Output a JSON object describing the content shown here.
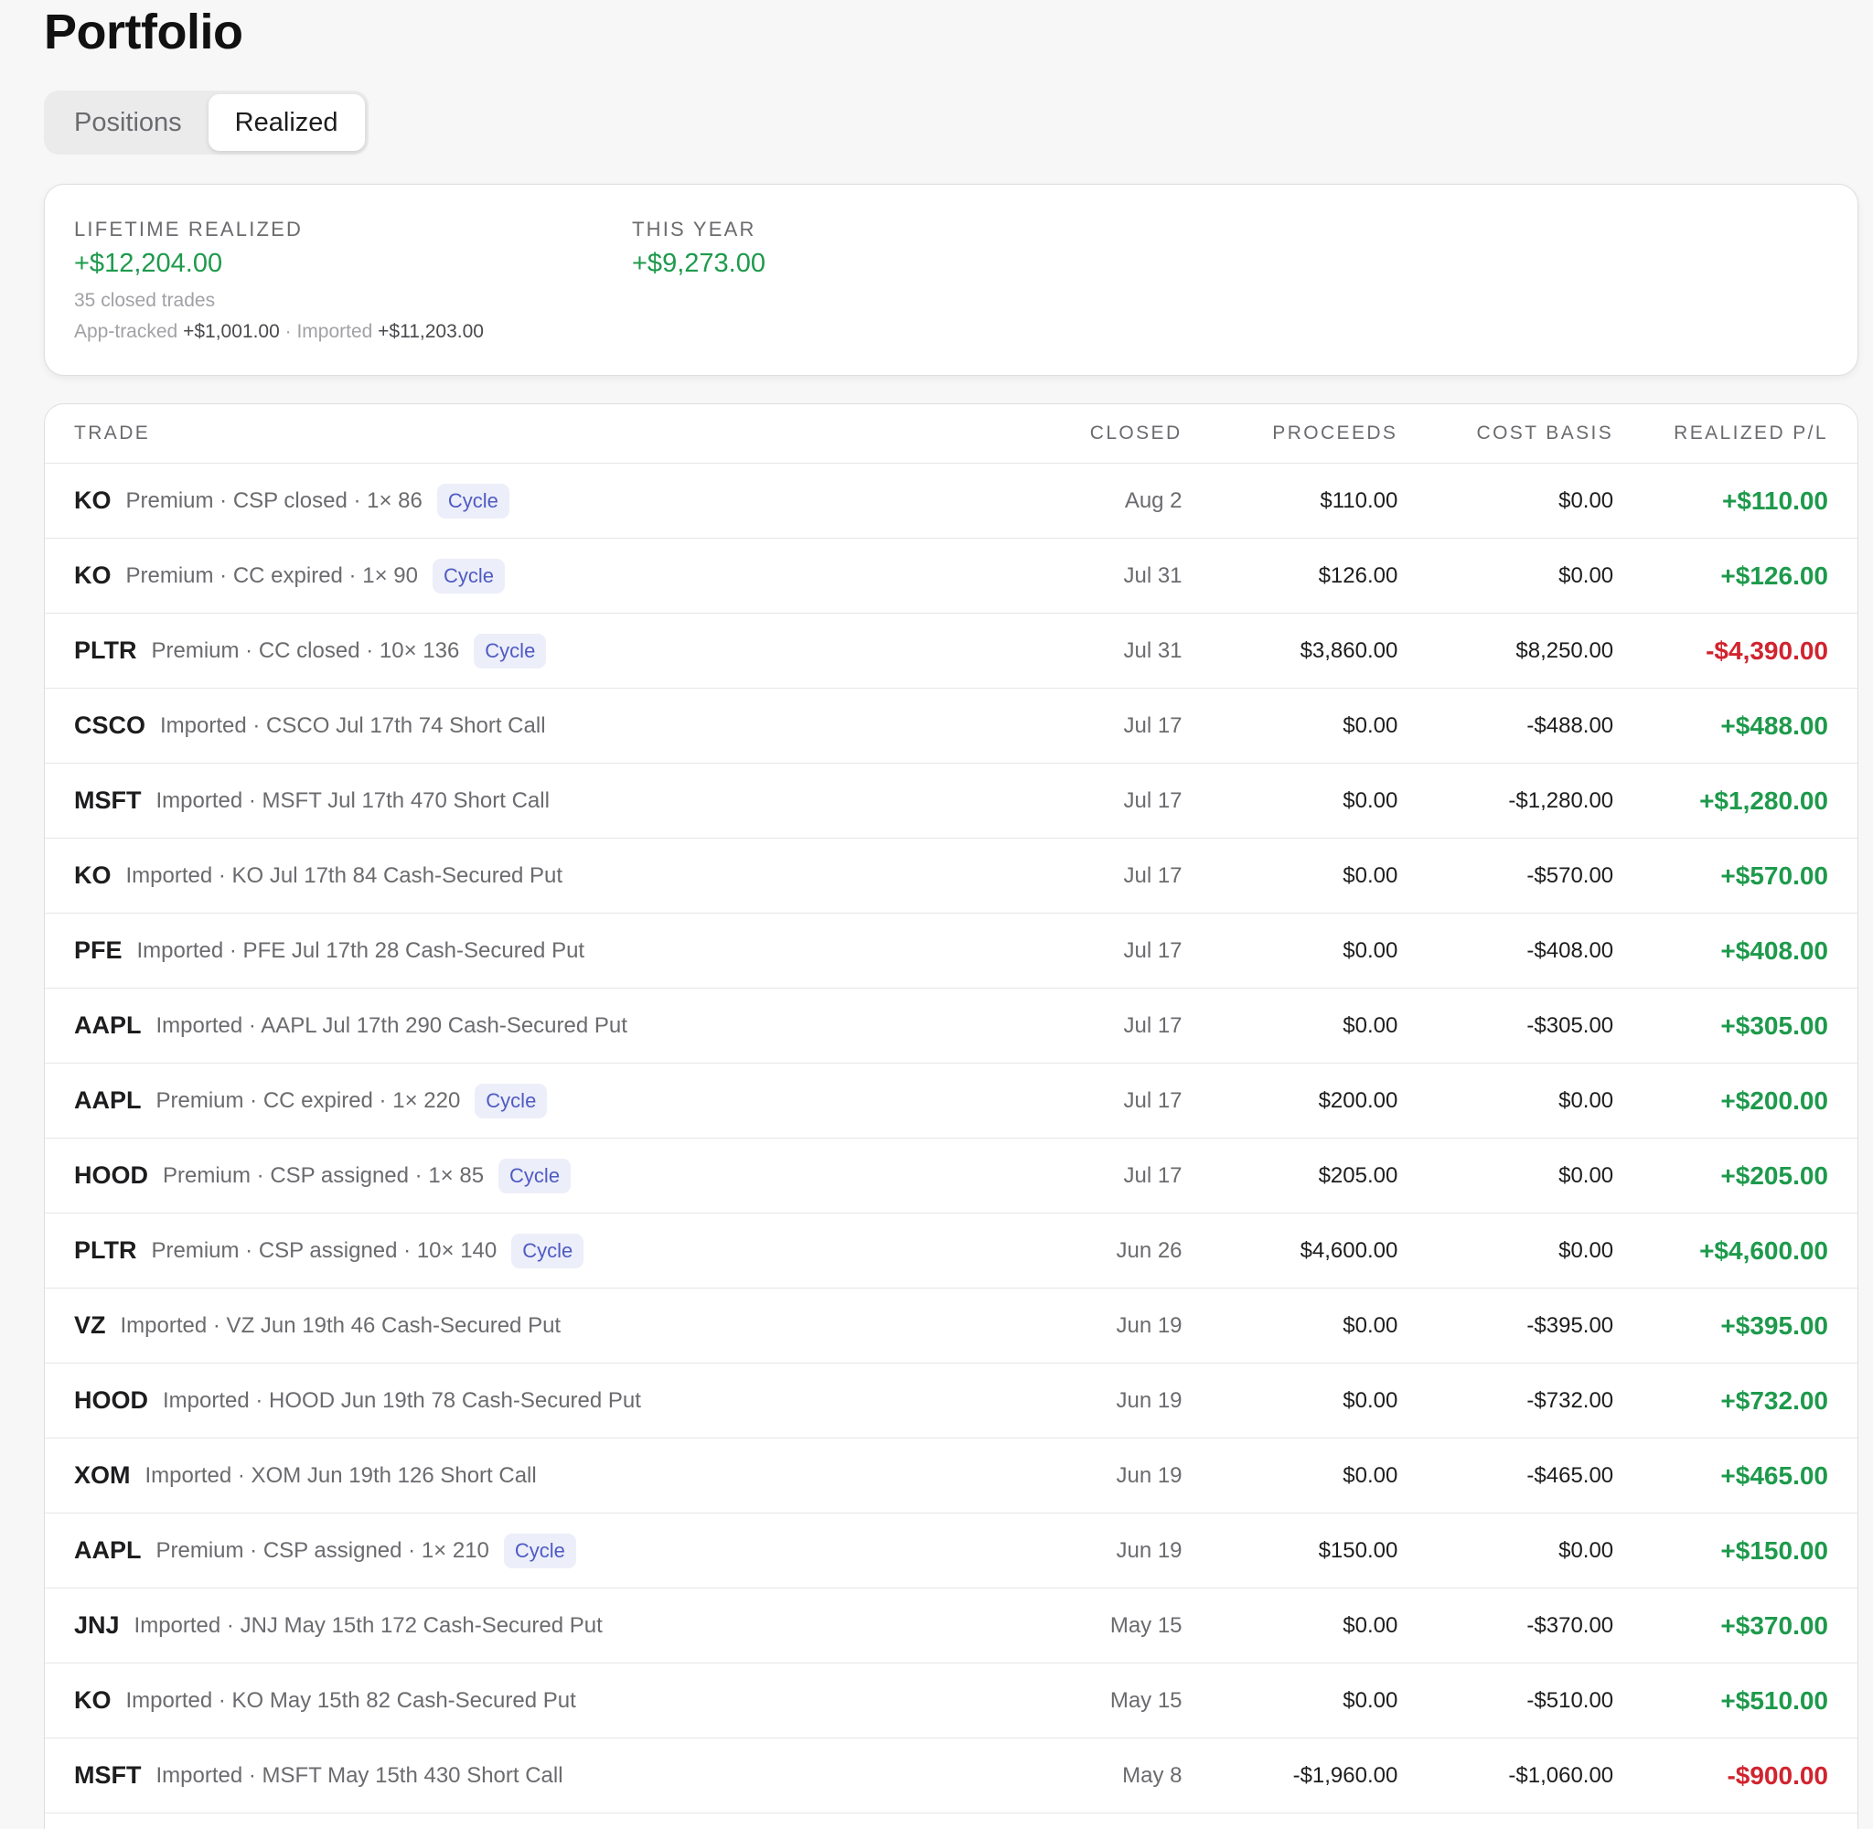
{
  "page": {
    "title": "Portfolio"
  },
  "tabs": [
    {
      "label": "Positions",
      "active": false
    },
    {
      "label": "Realized",
      "active": true
    }
  ],
  "summary": {
    "lifetime": {
      "label": "LIFETIME REALIZED",
      "value": "+$12,204.00",
      "closed_trades": "35 closed trades",
      "app_tracked_label": "App-tracked",
      "app_tracked_value": "+$1,001.00",
      "separator": "·",
      "imported_label": "Imported",
      "imported_value": "+$11,203.00"
    },
    "this_year": {
      "label": "THIS YEAR",
      "value": "+$9,273.00"
    }
  },
  "table": {
    "headers": {
      "trade": "TRADE",
      "closed": "CLOSED",
      "proceeds": "PROCEEDS",
      "cost_basis": "COST BASIS",
      "realized_pl": "REALIZED P/L"
    },
    "rows": [
      {
        "ticker": "KO",
        "desc": "Premium · CSP closed · 1× 86",
        "badge": "Cycle",
        "closed": "Aug 2",
        "proceeds": "$110.00",
        "cost": "$0.00",
        "pl": "+$110.00",
        "pl_sign": "pos"
      },
      {
        "ticker": "KO",
        "desc": "Premium · CC expired · 1× 90",
        "badge": "Cycle",
        "closed": "Jul 31",
        "proceeds": "$126.00",
        "cost": "$0.00",
        "pl": "+$126.00",
        "pl_sign": "pos"
      },
      {
        "ticker": "PLTR",
        "desc": "Premium · CC closed · 10× 136",
        "badge": "Cycle",
        "closed": "Jul 31",
        "proceeds": "$3,860.00",
        "cost": "$8,250.00",
        "pl": "-$4,390.00",
        "pl_sign": "neg"
      },
      {
        "ticker": "CSCO",
        "desc": "Imported · CSCO Jul 17th 74 Short Call",
        "badge": null,
        "closed": "Jul 17",
        "proceeds": "$0.00",
        "cost": "-$488.00",
        "pl": "+$488.00",
        "pl_sign": "pos"
      },
      {
        "ticker": "MSFT",
        "desc": "Imported · MSFT Jul 17th 470 Short Call",
        "badge": null,
        "closed": "Jul 17",
        "proceeds": "$0.00",
        "cost": "-$1,280.00",
        "pl": "+$1,280.00",
        "pl_sign": "pos"
      },
      {
        "ticker": "KO",
        "desc": "Imported · KO Jul 17th 84 Cash-Secured Put",
        "badge": null,
        "closed": "Jul 17",
        "proceeds": "$0.00",
        "cost": "-$570.00",
        "pl": "+$570.00",
        "pl_sign": "pos"
      },
      {
        "ticker": "PFE",
        "desc": "Imported · PFE Jul 17th 28 Cash-Secured Put",
        "badge": null,
        "closed": "Jul 17",
        "proceeds": "$0.00",
        "cost": "-$408.00",
        "pl": "+$408.00",
        "pl_sign": "pos"
      },
      {
        "ticker": "AAPL",
        "desc": "Imported · AAPL Jul 17th 290 Cash-Secured Put",
        "badge": null,
        "closed": "Jul 17",
        "proceeds": "$0.00",
        "cost": "-$305.00",
        "pl": "+$305.00",
        "pl_sign": "pos"
      },
      {
        "ticker": "AAPL",
        "desc": "Premium · CC expired · 1× 220",
        "badge": "Cycle",
        "closed": "Jul 17",
        "proceeds": "$200.00",
        "cost": "$0.00",
        "pl": "+$200.00",
        "pl_sign": "pos"
      },
      {
        "ticker": "HOOD",
        "desc": "Premium · CSP assigned · 1× 85",
        "badge": "Cycle",
        "closed": "Jul 17",
        "proceeds": "$205.00",
        "cost": "$0.00",
        "pl": "+$205.00",
        "pl_sign": "pos"
      },
      {
        "ticker": "PLTR",
        "desc": "Premium · CSP assigned · 10× 140",
        "badge": "Cycle",
        "closed": "Jun 26",
        "proceeds": "$4,600.00",
        "cost": "$0.00",
        "pl": "+$4,600.00",
        "pl_sign": "pos"
      },
      {
        "ticker": "VZ",
        "desc": "Imported · VZ Jun 19th 46 Cash-Secured Put",
        "badge": null,
        "closed": "Jun 19",
        "proceeds": "$0.00",
        "cost": "-$395.00",
        "pl": "+$395.00",
        "pl_sign": "pos"
      },
      {
        "ticker": "HOOD",
        "desc": "Imported · HOOD Jun 19th 78 Cash-Secured Put",
        "badge": null,
        "closed": "Jun 19",
        "proceeds": "$0.00",
        "cost": "-$732.00",
        "pl": "+$732.00",
        "pl_sign": "pos"
      },
      {
        "ticker": "XOM",
        "desc": "Imported · XOM Jun 19th 126 Short Call",
        "badge": null,
        "closed": "Jun 19",
        "proceeds": "$0.00",
        "cost": "-$465.00",
        "pl": "+$465.00",
        "pl_sign": "pos"
      },
      {
        "ticker": "AAPL",
        "desc": "Premium · CSP assigned · 1× 210",
        "badge": "Cycle",
        "closed": "Jun 19",
        "proceeds": "$150.00",
        "cost": "$0.00",
        "pl": "+$150.00",
        "pl_sign": "pos"
      },
      {
        "ticker": "JNJ",
        "desc": "Imported · JNJ May 15th 172 Cash-Secured Put",
        "badge": null,
        "closed": "May 15",
        "proceeds": "$0.00",
        "cost": "-$370.00",
        "pl": "+$370.00",
        "pl_sign": "pos"
      },
      {
        "ticker": "KO",
        "desc": "Imported · KO May 15th 82 Cash-Secured Put",
        "badge": null,
        "closed": "May 15",
        "proceeds": "$0.00",
        "cost": "-$510.00",
        "pl": "+$510.00",
        "pl_sign": "pos"
      },
      {
        "ticker": "MSFT",
        "desc": "Imported · MSFT May 15th 430 Short Call",
        "badge": null,
        "closed": "May 8",
        "proceeds": "-$1,960.00",
        "cost": "-$1,060.00",
        "pl": "-$900.00",
        "pl_sign": "neg"
      }
    ]
  },
  "colors": {
    "positive": "#1e9a4c",
    "negative": "#d1242f",
    "badge_text": "#4f5bc4",
    "badge_bg": "#eceef9"
  }
}
